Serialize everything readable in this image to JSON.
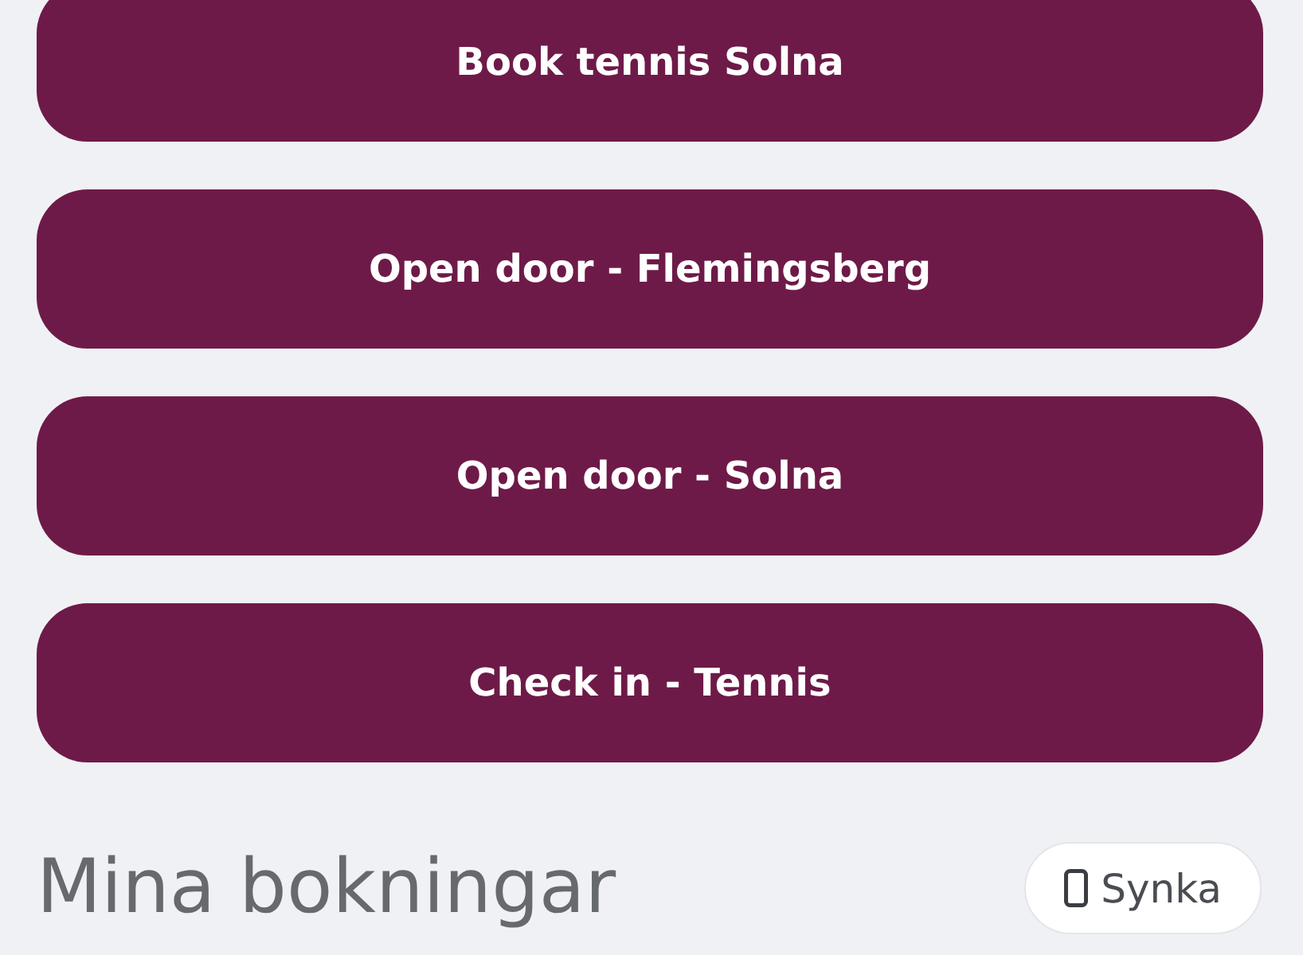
{
  "actions": [
    {
      "label": "Book tennis Solna"
    },
    {
      "label": "Open door - Flemingsberg"
    },
    {
      "label": "Open door - Solna"
    },
    {
      "label": "Check in - Tennis"
    }
  ],
  "bookings_section": {
    "title": "Mina bokningar",
    "sync_button": {
      "label": "Synka"
    }
  }
}
